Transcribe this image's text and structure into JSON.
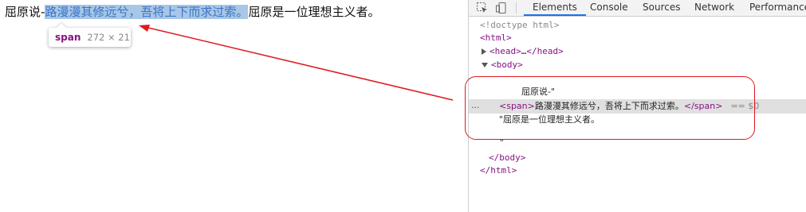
{
  "page": {
    "text_before": "屈原说-",
    "text_highlight": "路漫漫其修远兮，吾将上下而求过索。",
    "text_after": "屈原是一位理想主义者。"
  },
  "tooltip": {
    "tag": "span",
    "size": "272 × 21"
  },
  "devtools": {
    "tabs": [
      {
        "label": "Elements",
        "active": true
      },
      {
        "label": "Console",
        "active": false
      },
      {
        "label": "Sources",
        "active": false
      },
      {
        "label": "Network",
        "active": false
      },
      {
        "label": "Performance",
        "active": false
      }
    ],
    "icons": [
      "inspect-element-icon",
      "device-toolbar-icon"
    ],
    "dom": {
      "doctype": "<!doctype html>",
      "html_open": "<html>",
      "head_open": "<head>",
      "head_ellipsis": "…",
      "head_close": "</head>",
      "body_open": "<body>",
      "text_node_1": "屈原说-\"",
      "span_open": "<span>",
      "span_text": "路漫漫其修远兮，吾将上下而求过索。",
      "span_close": "</span>",
      "selected_marker": "== $0",
      "text_node_2": "\"屈原是一位理想主义者。",
      "quote_close": "\"",
      "body_close": "</body>",
      "html_close": "</html>",
      "ellipsis_marker": "..."
    }
  },
  "colors": {
    "highlight_bg": "#a8c7e6",
    "tag": "#881280",
    "annotation": "#e0191e",
    "tab_underline": "#1a73e8"
  }
}
